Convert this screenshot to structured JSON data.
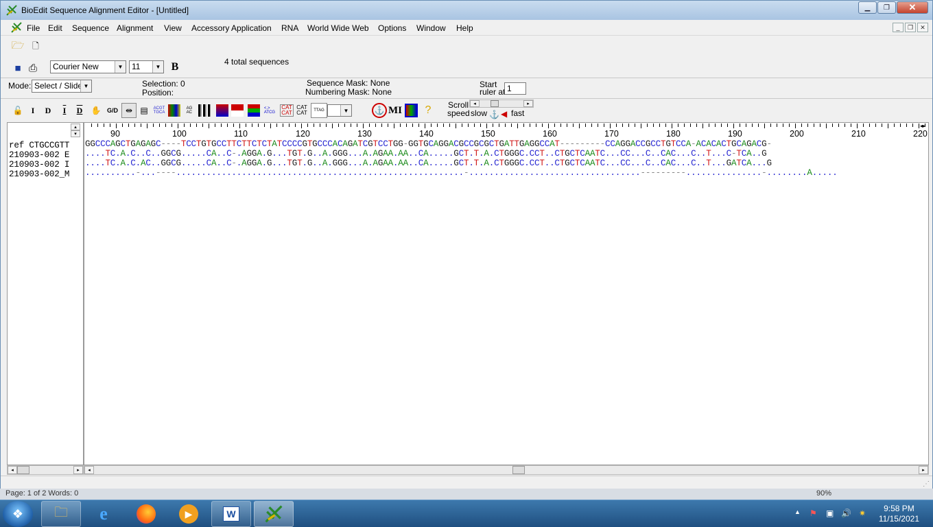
{
  "window": {
    "title": "BioEdit Sequence Alignment Editor - [Untitled]"
  },
  "menu": [
    "File",
    "Edit",
    "Sequence",
    "Alignment",
    "View",
    "Accessory Application",
    "RNA",
    "World Wide Web",
    "Options",
    "Window",
    "Help"
  ],
  "toolbar": {
    "font": "Courier New",
    "font_size": "11",
    "bold_label": "B",
    "total_sequences": "4 total sequences"
  },
  "mode": {
    "label": "Mode:",
    "value": "Select / Slide",
    "selection": "Selection: 0",
    "position": "Position:",
    "sequence_mask": "Sequence Mask: None",
    "numbering_mask": "Numbering Mask: None",
    "start_ruler": "Start",
    "ruler_at": "ruler at:",
    "ruler_value": "1"
  },
  "edit_tools": {
    "i_label": "I",
    "d_label": "D",
    "gd_label": "G/D",
    "mi_label": "MI"
  },
  "scroll": {
    "label": "Scroll",
    "speed": "speed",
    "slow": "slow",
    "fast": "fast"
  },
  "ruler": {
    "numbers": [
      "90",
      "100",
      "110",
      "120",
      "130",
      "140",
      "150",
      "160",
      "170",
      "180",
      "190",
      "200",
      "210",
      "220"
    ]
  },
  "sequences": [
    {
      "name": "ref CTGCCGTT",
      "seq": "GGCCCAGCTGAGAGC----TCCTGTGCCTTCTTCTCTATCCCCGTGCCCACAGATCGTCCTGG-GGTGCAGGACGCCGCGCTGATTGAGGCCAT---------CCAGGACCGCCTGTCCA-ACACACTGCAGACG-"
    },
    {
      "name": "210903-002 E",
      "seq": "....TC.A.C..C..GGCG.....CA..C-.AGGA.G...TGT.G..A.GGG...A.AGAA.AA..CA.....GCT.T.A.CTGGGC.CCT..CTGCTCAATC...CC...C..CAC...C..T...C-TCA..G"
    },
    {
      "name": "210903-002 I",
      "seq": "....TC.A.C.AC..GGCG.....CA..C-.AGGA.G...TGT.G..A.GGG...A.AGAA.AA..CA.....GCT.T.A.CTGGGC.CCT..CTGCTCAATC...CC...C..CAC...C..T...GATCA...G"
    },
    {
      "name": "210903-002_M",
      "seq": "..........-...----.........................................................-..................................---------...............-........A....."
    }
  ],
  "background": {
    "status_left": "Page: 1 of 2   Words: 0",
    "zoom": "90%"
  },
  "taskbar": {
    "time": "9:58 PM",
    "date": "11/15/2021"
  },
  "colors": {
    "A": "#1a8a1a",
    "C": "#2424d0",
    "G": "#222222",
    "T": "#d01818",
    "gap": "#888888"
  }
}
